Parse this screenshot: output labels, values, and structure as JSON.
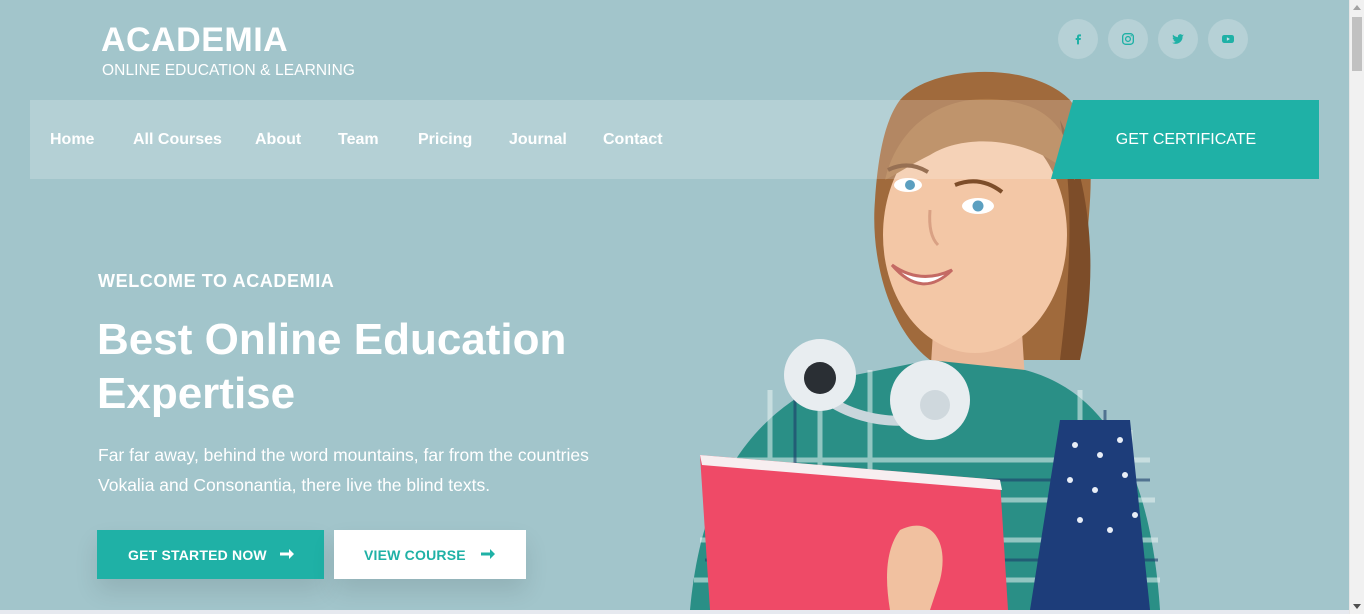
{
  "brand": {
    "title": "ACADEMIA",
    "subtitle": "ONLINE EDUCATION & LEARNING"
  },
  "social": [
    {
      "name": "facebook-icon"
    },
    {
      "name": "instagram-icon"
    },
    {
      "name": "twitter-icon"
    },
    {
      "name": "youtube-icon"
    }
  ],
  "nav": {
    "items": [
      "Home",
      "All Courses",
      "About",
      "Team",
      "Pricing",
      "Journal",
      "Contact"
    ],
    "cta": "GET CERTIFICATE"
  },
  "hero": {
    "kicker": "WELCOME TO ACADEMIA",
    "headline_line1": "Best Online Education",
    "headline_line2": "Expertise",
    "desc_line1": "Far far away, behind the word mountains, far from the countries",
    "desc_line2": "Vokalia and Consonantia, there live the blind texts.",
    "primary_button": "GET STARTED NOW",
    "secondary_button": "VIEW COURSE"
  },
  "colors": {
    "accent": "#1fb1a6",
    "background": "#a2c5cb",
    "text": "#ffffff"
  }
}
